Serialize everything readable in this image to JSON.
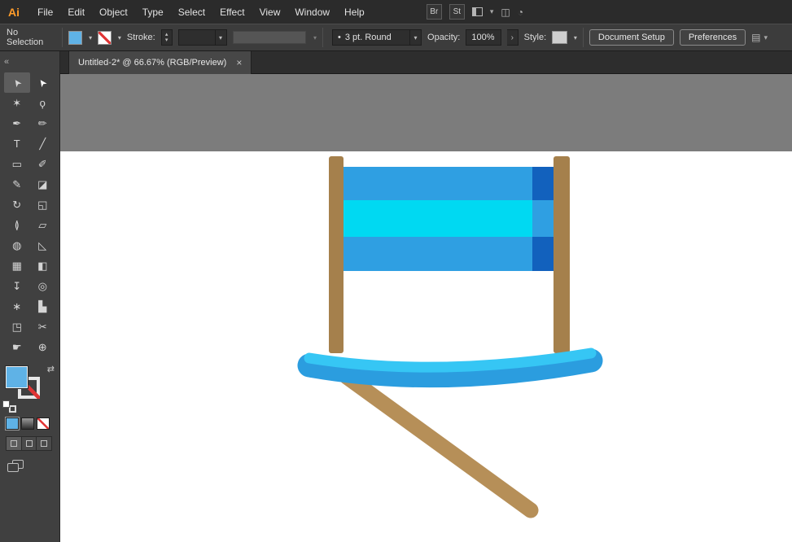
{
  "app": {
    "logo": "Ai"
  },
  "menubar": {
    "items": [
      "File",
      "Edit",
      "Object",
      "Type",
      "Select",
      "Effect",
      "View",
      "Window",
      "Help"
    ],
    "br_label": "Br",
    "st_label": "St"
  },
  "controlbar": {
    "selection_status": "No Selection",
    "stroke_label": "Stroke:",
    "stroke_width_value": "",
    "brush_bullet": "•",
    "brush_value": "3 pt. Round",
    "opacity_label": "Opacity:",
    "opacity_value": "100%",
    "style_label": "Style:",
    "document_setup_label": "Document Setup",
    "preferences_label": "Preferences"
  },
  "tabbar": {
    "title": "Untitled-2* @ 66.67% (RGB/Preview)"
  },
  "toolbar": {
    "tools": [
      {
        "name": "selection",
        "glyph": "➤",
        "selected": true
      },
      {
        "name": "direct-selection",
        "glyph": "➤"
      },
      {
        "name": "magic-wand",
        "glyph": "✶"
      },
      {
        "name": "lasso",
        "glyph": "ϙ"
      },
      {
        "name": "pen",
        "glyph": "✒"
      },
      {
        "name": "curvature",
        "glyph": "✏"
      },
      {
        "name": "type",
        "glyph": "T"
      },
      {
        "name": "line-segment",
        "glyph": "╱"
      },
      {
        "name": "rectangle",
        "glyph": "▭"
      },
      {
        "name": "paintbrush",
        "glyph": "✐"
      },
      {
        "name": "shaper",
        "glyph": "✎"
      },
      {
        "name": "eraser",
        "glyph": "◪"
      },
      {
        "name": "rotate",
        "glyph": "↻"
      },
      {
        "name": "scale",
        "glyph": "◱"
      },
      {
        "name": "width",
        "glyph": "≬"
      },
      {
        "name": "free-transform",
        "glyph": "▱"
      },
      {
        "name": "shape-builder",
        "glyph": "◍"
      },
      {
        "name": "perspective-grid",
        "glyph": "◺"
      },
      {
        "name": "mesh",
        "glyph": "▦"
      },
      {
        "name": "gradient",
        "glyph": "◧"
      },
      {
        "name": "eyedropper",
        "glyph": "↧"
      },
      {
        "name": "blend",
        "glyph": "◎"
      },
      {
        "name": "symbol-sprayer",
        "glyph": "∗"
      },
      {
        "name": "column-graph",
        "glyph": "▙"
      },
      {
        "name": "artboard",
        "glyph": "◳"
      },
      {
        "name": "slice",
        "glyph": "✂"
      },
      {
        "name": "hand",
        "glyph": "☛"
      },
      {
        "name": "zoom",
        "glyph": "⊕"
      }
    ]
  },
  "icons": {
    "chevron_down": "▾",
    "chevron_up": "▴",
    "submenu": "›",
    "collapse": "«",
    "swap": "⇄",
    "close": "×",
    "panel_menu": "▤",
    "window": "◫",
    "sync": "◔"
  },
  "swatches": {
    "fill": "#5fb2e6",
    "style_swatch": "#cfcfcf"
  },
  "artwork": {
    "colors": {
      "post": "#a5804c",
      "leg": "#b68f58",
      "stripe_blue": "#2f9fe2",
      "stripe_cyan": "#00d9f2",
      "stripe_dark": "#1261bd",
      "seat_light": "#36c6f4",
      "seat_main": "#2b9ddf"
    }
  }
}
